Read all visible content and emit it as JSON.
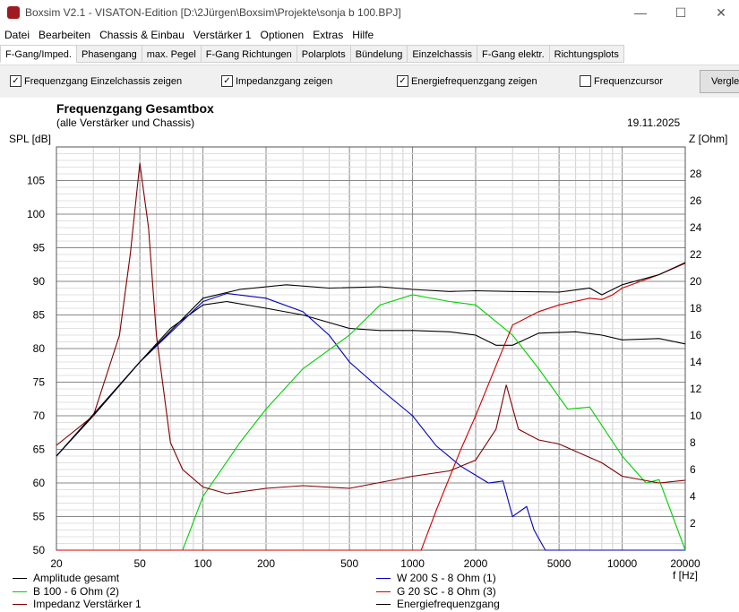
{
  "window": {
    "title": "Boxsim V2.1 - VISATON-Edition [D:\\2Jürgen\\Boxsim\\Projekte\\sonja b 100.BPJ]",
    "minimize": "—",
    "maximize": "☐",
    "close": "✕"
  },
  "menu": [
    "Datei",
    "Bearbeiten",
    "Chassis & Einbau",
    "Verstärker 1",
    "Optionen",
    "Extras",
    "Hilfe"
  ],
  "tabs": [
    "F-Gang/Imped.",
    "Phasengang",
    "max. Pegel",
    "F-Gang Richtungen",
    "Polarplots",
    "Bündelung",
    "Einzelchassis",
    "F-Gang elektr.",
    "Richtungsplots"
  ],
  "toolbar": {
    "checkboxes": [
      {
        "label": "Frequenzgang Einzelchassis zeigen",
        "checked": true
      },
      {
        "label": "Impedanzgang zeigen",
        "checked": true
      },
      {
        "label": "Energiefrequenzgang zeigen",
        "checked": true
      },
      {
        "label": "Frequenzcursor",
        "checked": false
      }
    ],
    "compare_button": "Vergle"
  },
  "chart_data": {
    "type": "line",
    "title": "Frequenzgang Gesamtbox",
    "subtitle": "(alle Verstärker und Chassis)",
    "date": "19.11.2025",
    "ylabel": "SPL [dB]",
    "y2label": "Z [Ohm]",
    "xlabel": "f [Hz]",
    "xscale": "log",
    "xlim": [
      20,
      20000
    ],
    "ylim": [
      50,
      110
    ],
    "y2lim": [
      0,
      30
    ],
    "xticks": [
      20,
      50,
      100,
      200,
      500,
      1000,
      2000,
      5000,
      10000,
      20000
    ],
    "yticks": [
      50,
      55,
      60,
      65,
      70,
      75,
      80,
      85,
      90,
      95,
      100,
      105
    ],
    "y2ticks": [
      2,
      4,
      6,
      8,
      10,
      12,
      14,
      16,
      18,
      20,
      22,
      24,
      26,
      28
    ],
    "series": [
      {
        "name": "Amplitude gesamt",
        "color": "#000000",
        "axis": "left",
        "points": [
          [
            20,
            64
          ],
          [
            30,
            70
          ],
          [
            50,
            78
          ],
          [
            70,
            83
          ],
          [
            100,
            86.5
          ],
          [
            130,
            87
          ],
          [
            200,
            86
          ],
          [
            300,
            85
          ],
          [
            500,
            83
          ],
          [
            700,
            82.7
          ],
          [
            1000,
            82.7
          ],
          [
            1500,
            82.5
          ],
          [
            2000,
            82
          ],
          [
            2500,
            80.5
          ],
          [
            3000,
            80.5
          ],
          [
            4000,
            82.3
          ],
          [
            6000,
            82.5
          ],
          [
            8000,
            82
          ],
          [
            10000,
            81.3
          ],
          [
            15000,
            81.5
          ],
          [
            20000,
            80.7
          ]
        ]
      },
      {
        "name": "W 200 S - 8 Ohm (1)",
        "color": "#0000c0",
        "axis": "left",
        "points": [
          [
            20,
            64
          ],
          [
            50,
            78
          ],
          [
            100,
            87
          ],
          [
            130,
            88.2
          ],
          [
            200,
            87.5
          ],
          [
            300,
            85.5
          ],
          [
            400,
            82
          ],
          [
            500,
            78
          ],
          [
            700,
            74
          ],
          [
            1000,
            70
          ],
          [
            1300,
            65.5
          ],
          [
            1700,
            62.5
          ],
          [
            2300,
            60
          ],
          [
            2700,
            60.3
          ],
          [
            3000,
            55
          ],
          [
            3500,
            56.5
          ],
          [
            3800,
            53
          ],
          [
            4300,
            50
          ],
          [
            20000,
            50
          ]
        ]
      },
      {
        "name": "B 100 - 6 Ohm (2)",
        "color": "#00d000",
        "axis": "left",
        "points": [
          [
            20,
            50
          ],
          [
            80,
            50
          ],
          [
            100,
            58
          ],
          [
            150,
            66
          ],
          [
            200,
            71
          ],
          [
            300,
            77
          ],
          [
            500,
            82
          ],
          [
            700,
            86.5
          ],
          [
            1000,
            88
          ],
          [
            1500,
            87
          ],
          [
            2000,
            86.5
          ],
          [
            3000,
            82
          ],
          [
            4000,
            77
          ],
          [
            5500,
            71
          ],
          [
            7000,
            71.3
          ],
          [
            10000,
            64
          ],
          [
            13000,
            60
          ],
          [
            15000,
            60.5
          ],
          [
            20000,
            50
          ]
        ]
      },
      {
        "name": "G 20 SC - 8 Ohm (3)",
        "color": "#d00000",
        "axis": "left",
        "points": [
          [
            20,
            50
          ],
          [
            1100,
            50
          ],
          [
            1300,
            56
          ],
          [
            1700,
            65
          ],
          [
            2000,
            70
          ],
          [
            3000,
            83.5
          ],
          [
            4000,
            85.5
          ],
          [
            5000,
            86.5
          ],
          [
            7000,
            87.5
          ],
          [
            8000,
            87.3
          ],
          [
            9000,
            88
          ],
          [
            10000,
            89
          ],
          [
            15000,
            91
          ],
          [
            20000,
            92.7
          ]
        ]
      },
      {
        "name": "Impedanz Verstärker 1",
        "color": "#800000",
        "axis": "right",
        "points": [
          [
            20,
            7.8
          ],
          [
            30,
            10
          ],
          [
            40,
            16
          ],
          [
            45,
            22
          ],
          [
            50,
            28.8
          ],
          [
            55,
            24
          ],
          [
            60,
            16
          ],
          [
            70,
            8
          ],
          [
            80,
            6
          ],
          [
            100,
            4.7
          ],
          [
            130,
            4.2
          ],
          [
            200,
            4.6
          ],
          [
            300,
            4.8
          ],
          [
            500,
            4.6
          ],
          [
            1000,
            5.5
          ],
          [
            1500,
            5.9
          ],
          [
            2000,
            6.7
          ],
          [
            2500,
            9
          ],
          [
            2800,
            12.3
          ],
          [
            3200,
            9
          ],
          [
            4000,
            8.2
          ],
          [
            5000,
            7.9
          ],
          [
            8000,
            6.5
          ],
          [
            10000,
            5.5
          ],
          [
            15000,
            5
          ],
          [
            20000,
            5.2
          ]
        ]
      },
      {
        "name": "Energiefrequenzgang",
        "color": "#000000",
        "axis": "left",
        "points": [
          [
            20,
            64
          ],
          [
            50,
            78
          ],
          [
            100,
            87.5
          ],
          [
            150,
            88.8
          ],
          [
            250,
            89.5
          ],
          [
            400,
            89
          ],
          [
            700,
            89.2
          ],
          [
            1000,
            88.8
          ],
          [
            1500,
            88.5
          ],
          [
            2000,
            88.6
          ],
          [
            3000,
            88.5
          ],
          [
            5000,
            88.4
          ],
          [
            7000,
            89
          ],
          [
            8000,
            88
          ],
          [
            10000,
            89.5
          ],
          [
            15000,
            91
          ],
          [
            20000,
            92.8
          ]
        ]
      }
    ]
  }
}
